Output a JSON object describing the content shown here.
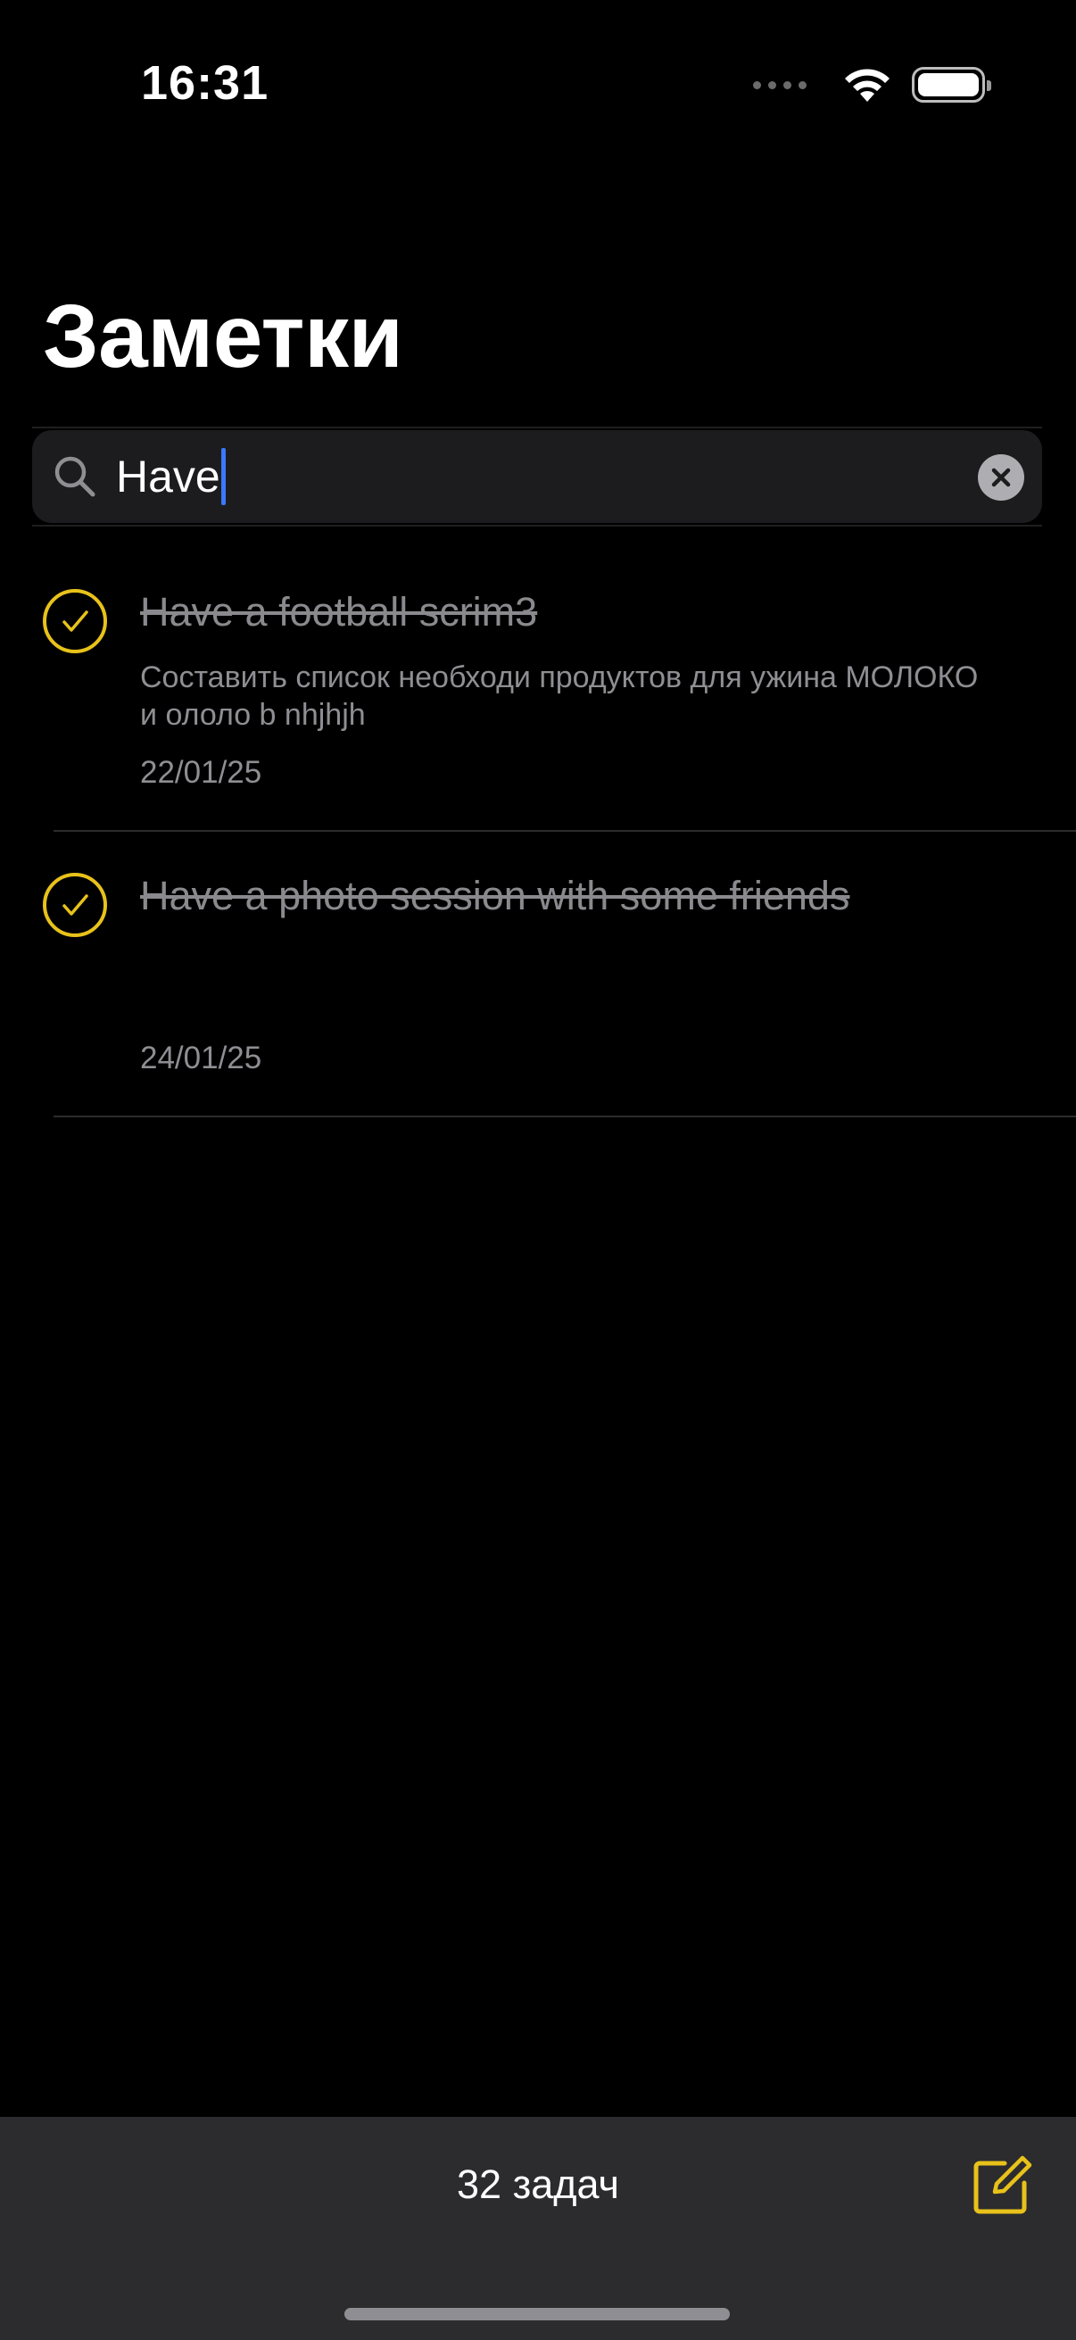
{
  "status_bar": {
    "time": "16:31",
    "icons": [
      "cellular-dots-icon",
      "wifi-icon",
      "battery-icon"
    ]
  },
  "header": {
    "title": "Заметки"
  },
  "search": {
    "value": "Have",
    "icon": "search-icon",
    "clear_icon": "clear-icon"
  },
  "tasks": [
    {
      "title": "Have a football scrim3",
      "description": "Составить список необходи продуктов для ужина МОЛОКО и ололо b nhjhjh",
      "date": "22/01/25",
      "completed": true
    },
    {
      "title": "Have a photo session with some friends",
      "description": "",
      "date": "24/01/25",
      "completed": true
    }
  ],
  "toolbar": {
    "task_count_label": "32 задач",
    "compose_icon": "compose-icon"
  },
  "colors": {
    "background": "#000000",
    "accent": "#E8C21A",
    "toolbar": "#2C2C2E",
    "muted_text": "#8E8E93",
    "caret": "#3A78FF"
  }
}
